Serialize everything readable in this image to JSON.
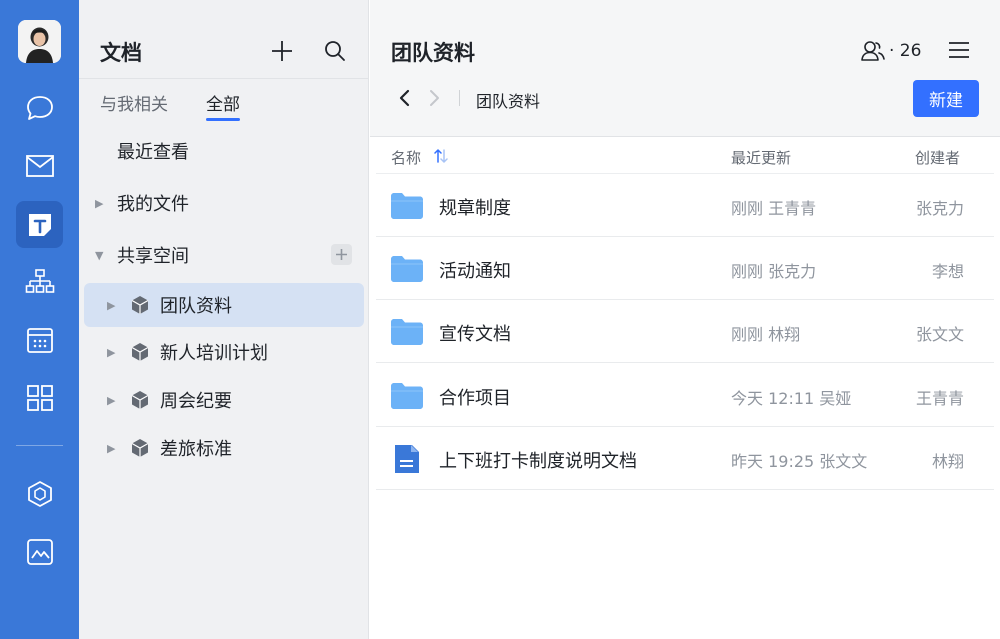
{
  "colors": {
    "rail": "#3a78d8",
    "accent": "#3370ff",
    "folder": "#6cb2f7",
    "doc": "#3a78d8"
  },
  "rail": {
    "items": [
      {
        "icon": "chat-icon",
        "active": false
      },
      {
        "icon": "mail-icon",
        "active": false
      },
      {
        "icon": "docs-icon",
        "active": true
      },
      {
        "icon": "org-chart-icon",
        "active": false
      },
      {
        "icon": "calendar-icon",
        "active": false
      },
      {
        "icon": "apps-grid-icon",
        "active": false
      },
      {
        "icon": "cube-icon",
        "active": false
      },
      {
        "icon": "image-icon",
        "active": false
      }
    ]
  },
  "panel": {
    "title": "文档",
    "tabs": [
      {
        "label": "与我相关",
        "active": false
      },
      {
        "label": "全部",
        "active": true
      }
    ],
    "recent": "最近查看",
    "my_files": "我的文件",
    "shared": "共享空间",
    "spaces": [
      {
        "label": "团队资料",
        "selected": true
      },
      {
        "label": "新人培训计划",
        "selected": false
      },
      {
        "label": "周会纪要",
        "selected": false
      },
      {
        "label": "差旅标准",
        "selected": false
      }
    ]
  },
  "main": {
    "title": "团队资料",
    "member_count": "· 26",
    "breadcrumb": "团队资料",
    "new_button": "新建",
    "columns": {
      "name": "名称",
      "updated": "最近更新",
      "creator": "创建者"
    },
    "rows": [
      {
        "type": "folder",
        "name": "规章制度",
        "updated": "刚刚  王青青",
        "creator": "张克力"
      },
      {
        "type": "folder",
        "name": "活动通知",
        "updated": "刚刚  张克力",
        "creator": "李想"
      },
      {
        "type": "folder",
        "name": "宣传文档",
        "updated": "刚刚  林翔",
        "creator": "张文文"
      },
      {
        "type": "folder",
        "name": "合作项目",
        "updated": "今天 12:11  吴娅",
        "creator": "王青青"
      },
      {
        "type": "doc",
        "name": "上下班打卡制度说明文档",
        "updated": "昨天 19:25  张文文",
        "creator": "林翔"
      }
    ]
  }
}
